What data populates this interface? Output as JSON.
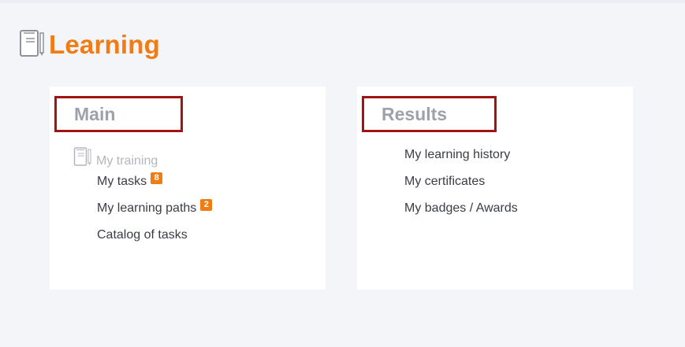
{
  "header": {
    "icon": "book-icon",
    "title": "Learning",
    "accent_color": "#f07c16"
  },
  "main_card": {
    "heading": "Main",
    "group": {
      "icon": "book-icon",
      "label": "My training"
    },
    "items": [
      {
        "label": "My tasks",
        "badge": "8"
      },
      {
        "label": "My learning paths",
        "badge": "2"
      },
      {
        "label": "Catalog of tasks"
      }
    ]
  },
  "results_card": {
    "heading": "Results",
    "items": [
      {
        "label": "My learning history"
      },
      {
        "label": "My certificates"
      },
      {
        "label": "My badges / Awards"
      }
    ]
  },
  "highlight_color": "#a01414"
}
